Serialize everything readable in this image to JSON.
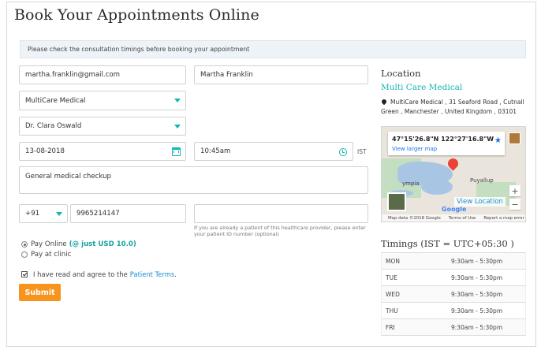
{
  "page": {
    "title": "Book Your Appointments Online",
    "notice": "Please check the consultation timings before booking your appointment"
  },
  "form": {
    "email": "martha.franklin@gmail.com",
    "name": "Martha Franklin",
    "clinic": "MultiCare Medical",
    "doctor": "Dr. Clara Oswald",
    "date": "13-08-2018",
    "time": "10:45am",
    "timezone_label": "IST",
    "reason": "General medical checkup",
    "country_code": "+91",
    "phone": "9965214147",
    "patient_id": "",
    "patient_id_help": "If you are already a patient of this healthcare provider, please enter your patient ID number (optional)",
    "pay_online_label": "Pay Online",
    "pay_online_extra": "(@ just USD 10.0)",
    "pay_clinic_label": "Pay at clinic",
    "agree_text": "I have read and agree to the",
    "terms_link": "Patient Terms",
    "agree_end": ".",
    "submit_label": "Submit"
  },
  "location": {
    "heading": "Location",
    "clinic_name": "Multi Care Medical",
    "address": "MultiCare Medical , 31 Seaford Road , Cutnall Green , Manchester , United Kingdom , 03101",
    "map": {
      "coordinates": "47°15'26.8\"N 122°27'16.8\"W",
      "view_larger": "View larger map",
      "view_location": "View Location",
      "zoom_in": "+",
      "zoom_out": "−",
      "place_puyallup": "Puyallup",
      "place_olympia": "ympia",
      "google_logo": "Google",
      "footer": [
        "Map data ©2018 Google",
        "Terms of Use",
        "Report a map error"
      ]
    }
  },
  "timings": {
    "heading": "Timings (IST = UTC+05:30 )",
    "rows": [
      {
        "day": "MON",
        "hours": "9:30am - 5:30pm"
      },
      {
        "day": "TUE",
        "hours": "9:30am - 5:30pm"
      },
      {
        "day": "WED",
        "hours": "9:30am - 5:30pm"
      },
      {
        "day": "THU",
        "hours": "9:30am - 5:30pm"
      },
      {
        "day": "FRI",
        "hours": "9:30am - 5:30pm"
      }
    ]
  },
  "colors": {
    "accent": "#13b5b1",
    "submit": "#f7941d",
    "link": "#1a8ed0"
  }
}
